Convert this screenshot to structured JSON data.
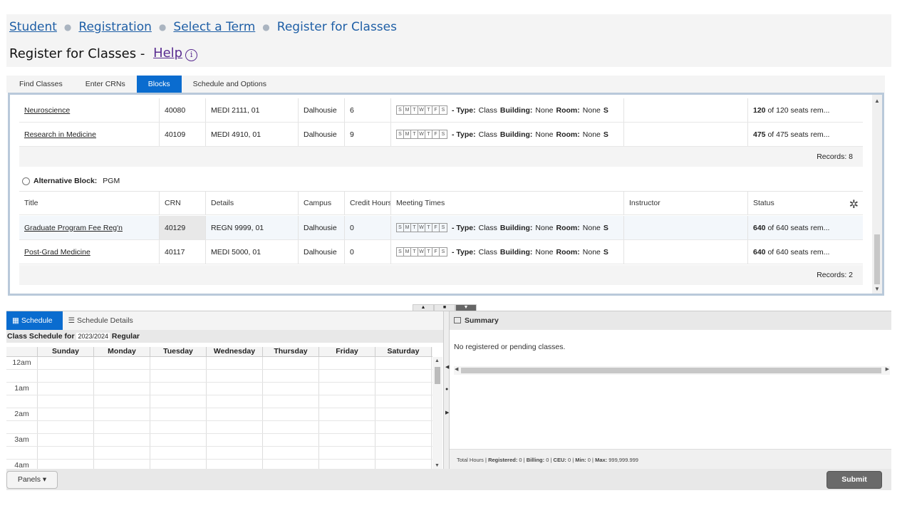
{
  "breadcrumb": {
    "items": [
      "Student",
      "Registration",
      "Select a Term"
    ],
    "current": "Register for Classes"
  },
  "page": {
    "title": "Register for Classes - ",
    "help_label": "Help"
  },
  "tabs": [
    "Find Classes",
    "Enter CRNs",
    "Blocks",
    "Schedule and Options"
  ],
  "block_rows": [
    {
      "title": "Neuroscience",
      "crn": "40080",
      "details": "MEDI 2111, 01",
      "campus": "Dalhousie",
      "credit": "6",
      "status_bold": "120",
      "status_rest": " of 120 seats rem..."
    },
    {
      "title": "Research in Medicine",
      "crn": "40109",
      "details": "MEDI 4910, 01",
      "campus": "Dalhousie",
      "credit": "9",
      "status_bold": "475",
      "status_rest": " of 475 seats rem..."
    }
  ],
  "records_1": "Records: 8",
  "alt_block": {
    "label": "Alternative Block:",
    "value": "PGM"
  },
  "columns": {
    "title": "Title",
    "crn": "CRN",
    "details": "Details",
    "campus": "Campus",
    "credit": "Credit Hours",
    "meeting": "Meeting Times",
    "instructor": "Instructor",
    "status": "Status"
  },
  "alt_rows": [
    {
      "title": "Graduate Program Fee Reg'n",
      "crn": "40129",
      "details": "REGN 9999, 01",
      "campus": "Dalhousie",
      "credit": "0",
      "status_bold": "640",
      "status_rest": " of 640 seats rem..."
    },
    {
      "title": "Post-Grad Medicine",
      "crn": "40117",
      "details": "MEDI 5000, 01",
      "campus": "Dalhousie",
      "credit": "0",
      "status_bold": "640",
      "status_rest": " of 640 seats rem..."
    }
  ],
  "records_2": "Records: 2",
  "meeting": {
    "days": [
      "S",
      "M",
      "T",
      "W",
      "T",
      "F",
      "S"
    ],
    "type_label": "- Type:",
    "type_value": "Class",
    "building_label": "Building:",
    "building_value": "None",
    "room_label": "Room:",
    "room_value": "None",
    "trail": "S"
  },
  "schedule": {
    "tab_schedule": "Schedule",
    "tab_details": "Schedule Details",
    "title_prefix": "Class Schedule for",
    "term": "2023/2024",
    "title_suffix": "Regular",
    "days": [
      "Sunday",
      "Monday",
      "Tuesday",
      "Wednesday",
      "Thursday",
      "Friday",
      "Saturday"
    ],
    "times": [
      "12am",
      "1am",
      "2am",
      "3am",
      "4am"
    ]
  },
  "summary": {
    "title": "Summary",
    "message": "No registered or pending classes.",
    "footer_prefix": "Total Hours |",
    "registered_label": "Registered:",
    "registered_value": "0",
    "billing_label": "Billing:",
    "billing_value": "0",
    "ceu_label": "CEU:",
    "ceu_value": "0",
    "min_label": "Min:",
    "min_value": "0",
    "max_label": "Max:",
    "max_value": "999,999.999"
  },
  "buttons": {
    "panels": "Panels",
    "submit": "Submit"
  },
  "colors": {
    "accent": "#0a6ccf",
    "link": "#1f5fa6",
    "help": "#5a2d91"
  }
}
